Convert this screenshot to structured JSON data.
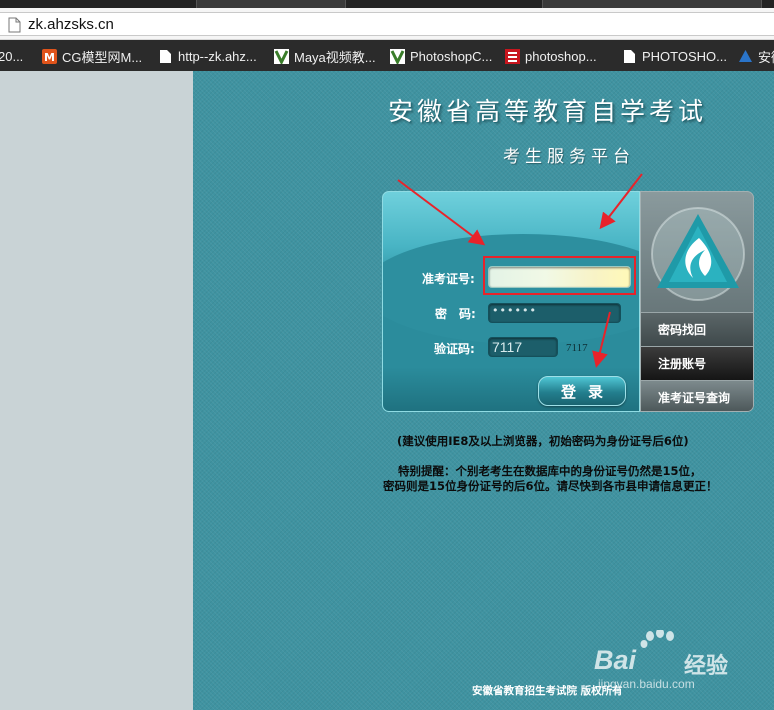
{
  "browser": {
    "url": "zk.ahzsks.cn",
    "bookmarks": [
      {
        "label": "20...",
        "icon": "page-icon"
      },
      {
        "label": "CG模型网M...",
        "icon": "cg-logo-icon"
      },
      {
        "label": "http--zk.ahz...",
        "icon": "page-icon"
      },
      {
        "label": "Maya视频教...",
        "icon": "v-logo-icon"
      },
      {
        "label": "PhotoshopC...",
        "icon": "v-logo-icon"
      },
      {
        "label": "photoshop...",
        "icon": "red-logo-icon"
      },
      {
        "label": "PHOTOSHO...",
        "icon": "page-icon"
      },
      {
        "label": "安徽",
        "icon": "blue-logo-icon"
      }
    ]
  },
  "site": {
    "title": "安徽省高等教育自学考试",
    "subtitle": "考生服务平台"
  },
  "login": {
    "id_label": "准考证号:",
    "id_value": "",
    "password_label": "密　码:",
    "password_mask": "••••••",
    "captcha_label": "验证码:",
    "captcha_value": "7117",
    "captcha_image_text": "7117",
    "submit_label": "登录"
  },
  "nav": {
    "items": [
      "密码找回",
      "注册账号",
      "准考证号查询"
    ]
  },
  "notices": {
    "browser_tip": "(建议使用IE8及以上浏览器，初始密码为身份证号后6位)",
    "reminder_line1": "特别提醒：个别老考生在数据库中的身份证号仍然是15位，",
    "reminder_line2": "密码则是15位身份证号的后6位。请尽快到各市县申请信息更正！"
  },
  "footer": {
    "text": "安徽省教育招生考试院  版权所有"
  },
  "watermark": {
    "brand": "Bai",
    "brand_cn": "经验",
    "url": "jingyan.baidu.com"
  },
  "colors": {
    "site_bg": "#3f93a1",
    "annotation_red": "#e8232a",
    "gutter": "#c9d3d6"
  }
}
